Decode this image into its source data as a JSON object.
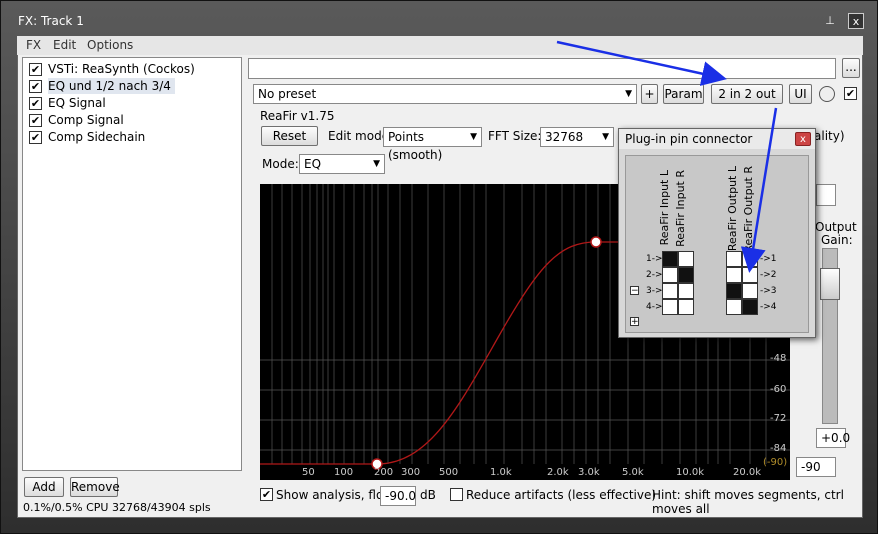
{
  "window": {
    "title": "FX: Track 1",
    "pin_glyph": "⊥",
    "close_glyph": "x"
  },
  "menu": [
    "FX",
    "Edit",
    "Options"
  ],
  "fx_chain": [
    {
      "label": "VSTi: ReaSynth (Cockos)",
      "checked": true
    },
    {
      "label": "EQ und 1/2 nach 3/4",
      "checked": true,
      "selected": true
    },
    {
      "label": "EQ Signal",
      "checked": true
    },
    {
      "label": "Comp Signal",
      "checked": true
    },
    {
      "label": "Comp Sidechain",
      "checked": true
    }
  ],
  "chain_buttons": {
    "add": "Add",
    "remove": "Remove"
  },
  "status": "0.1%/0.5% CPU 32768/43904 spls",
  "toolbar": {
    "more": "...",
    "preset": "No preset",
    "plus": "+",
    "param": "Param",
    "io": "2 in 2 out",
    "ui": "UI"
  },
  "plugin": {
    "name": "ReaFir v1.75",
    "reset": "Reset",
    "edit_mode_label": "Edit mode:",
    "edit_mode": "Points (smooth)",
    "fft_label": "FFT Size:",
    "fft": "32768",
    "quality_label": "ality)",
    "mode_label": "Mode:",
    "mode": "EQ",
    "output_label": "Output",
    "gain_label": "Gain:",
    "gain_value": "+0.0",
    "floor_field": "-90",
    "show_analysis": "Show analysis, floor:",
    "floor_value": "-90.0",
    "db": "dB",
    "reduce": "Reduce artifacts (less effective)",
    "hint": "Hint: shift moves segments, ctrl moves all"
  },
  "graph": {
    "x_labels": [
      "50",
      "100",
      "200",
      "300",
      "500",
      "1.0k",
      "2.0k",
      "3.0k",
      "5.0k",
      "10.0k",
      "20.0k"
    ],
    "y_labels": [
      "-48",
      "-60",
      "-72",
      "-84"
    ],
    "floor_label": "(-90)",
    "label_color": "#cccccc",
    "curve_color": "#b01818"
  },
  "pin_dialog": {
    "title": "Plug-in pin connector",
    "close": "x",
    "inputs": [
      "ReaFir Input L",
      "ReaFir Input R"
    ],
    "outputs": [
      "ReaFir Output L",
      "ReaFir Output R"
    ],
    "in_rows": [
      "1->",
      "2->",
      "3->",
      "4->"
    ],
    "out_rows": [
      "->1",
      "->2",
      "->3",
      "->4"
    ],
    "minus": "−",
    "plus": "+"
  },
  "arrow_color": "#1a2fe6"
}
